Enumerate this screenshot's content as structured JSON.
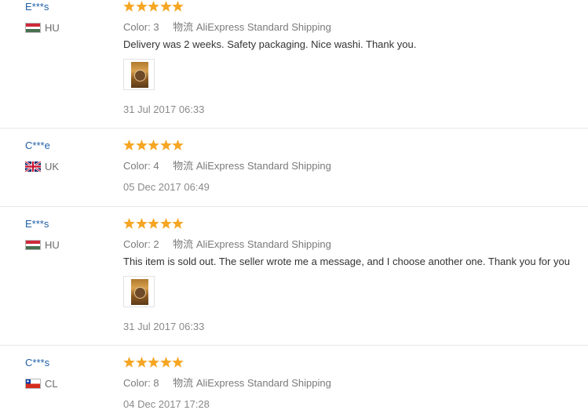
{
  "reviews": [
    {
      "user": "E***s",
      "country": "HU",
      "flag": "hungary",
      "rating": 5,
      "color_label": "Color:",
      "color_value": "3",
      "shipping_prefix": "物流",
      "shipping": "AliExpress Standard Shipping",
      "feedback": "Delivery was 2 weeks. Safety packaging. Nice washi. Thank you.",
      "has_photo": true,
      "date": "31 Jul 2017 06:33"
    },
    {
      "user": "C***e",
      "country": "UK",
      "flag": "united-kingdom",
      "rating": 5,
      "color_label": "Color:",
      "color_value": "4",
      "shipping_prefix": "物流",
      "shipping": "AliExpress Standard Shipping",
      "feedback": "",
      "has_photo": false,
      "date": "05 Dec 2017 06:49"
    },
    {
      "user": "E***s",
      "country": "HU",
      "flag": "hungary",
      "rating": 5,
      "color_label": "Color:",
      "color_value": "2",
      "shipping_prefix": "物流",
      "shipping": "AliExpress Standard Shipping",
      "feedback": "This item is sold out. The seller wrote me a message, and I choose another one. Thank you for you",
      "has_photo": true,
      "date": "31 Jul 2017 06:33"
    },
    {
      "user": "C***s",
      "country": "CL",
      "flag": "chile",
      "rating": 5,
      "color_label": "Color:",
      "color_value": "8",
      "shipping_prefix": "物流",
      "shipping": "AliExpress Standard Shipping",
      "feedback": "",
      "has_photo": false,
      "date": "04 Dec 2017 17:28"
    }
  ],
  "colors": {
    "star": "#f5a623",
    "username": "#1f5fa7",
    "meta": "#7a7a7a",
    "text": "#333333",
    "date": "#8a8a8a",
    "divider": "#e8e8e8"
  }
}
